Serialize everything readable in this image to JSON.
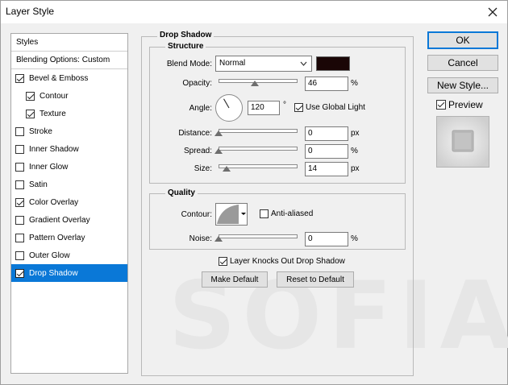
{
  "window": {
    "title": "Layer Style"
  },
  "watermark": "SOFIA",
  "sidebar": {
    "items": [
      {
        "label": "Styles",
        "checkbox": false,
        "checked": false,
        "indent": 0,
        "selected": false
      },
      {
        "label": "Blending Options: Custom",
        "checkbox": false,
        "checked": false,
        "indent": 0,
        "selected": false
      },
      {
        "label": "Bevel & Emboss",
        "checkbox": true,
        "checked": true,
        "indent": 0,
        "selected": false
      },
      {
        "label": "Contour",
        "checkbox": true,
        "checked": true,
        "indent": 1,
        "selected": false
      },
      {
        "label": "Texture",
        "checkbox": true,
        "checked": true,
        "indent": 1,
        "selected": false
      },
      {
        "label": "Stroke",
        "checkbox": true,
        "checked": false,
        "indent": 0,
        "selected": false
      },
      {
        "label": "Inner Shadow",
        "checkbox": true,
        "checked": false,
        "indent": 0,
        "selected": false
      },
      {
        "label": "Inner Glow",
        "checkbox": true,
        "checked": false,
        "indent": 0,
        "selected": false
      },
      {
        "label": "Satin",
        "checkbox": true,
        "checked": false,
        "indent": 0,
        "selected": false
      },
      {
        "label": "Color Overlay",
        "checkbox": true,
        "checked": true,
        "indent": 0,
        "selected": false
      },
      {
        "label": "Gradient Overlay",
        "checkbox": true,
        "checked": false,
        "indent": 0,
        "selected": false
      },
      {
        "label": "Pattern Overlay",
        "checkbox": true,
        "checked": false,
        "indent": 0,
        "selected": false
      },
      {
        "label": "Outer Glow",
        "checkbox": true,
        "checked": false,
        "indent": 0,
        "selected": false
      },
      {
        "label": "Drop Shadow",
        "checkbox": true,
        "checked": true,
        "indent": 0,
        "selected": true
      }
    ]
  },
  "panel": {
    "title": "Drop Shadow",
    "structure": {
      "title": "Structure",
      "blend_mode_label": "Blend Mode:",
      "blend_mode_value": "Normal",
      "shadow_color": "#1a0606",
      "opacity_label": "Opacity:",
      "opacity_value": "46",
      "opacity_unit": "%",
      "opacity_fraction": 0.46,
      "angle_label": "Angle:",
      "angle_value": "120",
      "angle_unit": "°",
      "use_global_light_label": "Use Global Light",
      "use_global_light_checked": true,
      "distance_label": "Distance:",
      "distance_value": "0",
      "distance_unit": "px",
      "distance_fraction": 0,
      "spread_label": "Spread:",
      "spread_value": "0",
      "spread_unit": "%",
      "spread_fraction": 0,
      "size_label": "Size:",
      "size_value": "14",
      "size_unit": "px",
      "size_fraction": 0.1
    },
    "quality": {
      "title": "Quality",
      "contour_label": "Contour:",
      "anti_aliased_label": "Anti-aliased",
      "anti_aliased_checked": false,
      "noise_label": "Noise:",
      "noise_value": "0",
      "noise_unit": "%",
      "noise_fraction": 0
    },
    "knockout_label": "Layer Knocks Out Drop Shadow",
    "knockout_checked": true,
    "make_default_label": "Make Default",
    "reset_default_label": "Reset to Default"
  },
  "buttons": {
    "ok": "OK",
    "cancel": "Cancel",
    "new_style": "New Style...",
    "preview_label": "Preview",
    "preview_checked": true
  },
  "colors": {
    "accent": "#0a78d7",
    "selected_text": "#ffffff"
  },
  "icons": {
    "close": "close-icon",
    "dropdown": "chevron-down-icon",
    "angle": "angle-dial-icon"
  }
}
